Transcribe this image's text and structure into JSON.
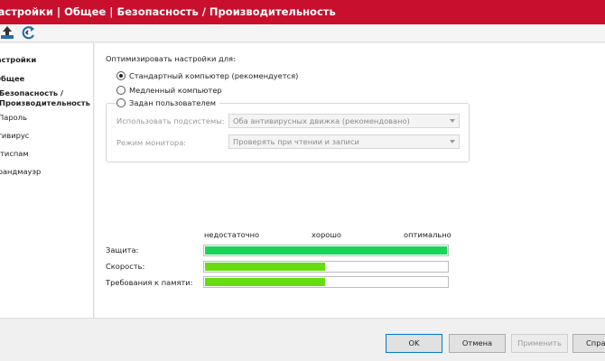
{
  "window": {
    "title": "Настройки | Общее | Безопасность / Производительность"
  },
  "toolbar": {
    "icons": [
      "upload-icon",
      "refresh-icon"
    ]
  },
  "sidebar": {
    "items": [
      {
        "label": "Настройки",
        "bold": true
      },
      {
        "label": "Общее",
        "bold": true
      },
      {
        "label": "Безопасность /",
        "bold": true
      },
      {
        "label": "Производительность",
        "bold": true
      },
      {
        "label": "Пароль",
        "bold": false
      },
      {
        "label": "Антивирус",
        "bold": false
      },
      {
        "label": "Антиспам",
        "bold": false
      },
      {
        "label": "Брандмауэр",
        "bold": false
      }
    ]
  },
  "main": {
    "optimize_label": "Оптимизировать настройки для:",
    "radios": [
      {
        "label": "Стандартный компьютер (рекомендуется)",
        "selected": true
      },
      {
        "label": "Медленный компьютер",
        "selected": false
      },
      {
        "label": "Задан пользователем",
        "selected": false
      }
    ],
    "subsystems_label": "Использовать подсистемы:",
    "subsystems_value": "Оба антивирусных движка (рекомендовано)",
    "monitor_label": "Режим монитора:",
    "monitor_value": "Проверять при чтении и записи",
    "scale": {
      "low": "недостаточно",
      "mid": "хорошо",
      "high": "оптимально"
    },
    "meters": [
      {
        "label": "Защита:",
        "fraction": 1.0,
        "color": "#19d35a"
      },
      {
        "label": "Скорость:",
        "fraction": 0.5,
        "color": "#66dd11"
      },
      {
        "label": "Требования к памяти:",
        "fraction": 0.5,
        "color": "#66dd11"
      }
    ]
  },
  "buttons": {
    "ok": "OK",
    "cancel": "Отмена",
    "apply": "Применить",
    "help": "Справка"
  }
}
